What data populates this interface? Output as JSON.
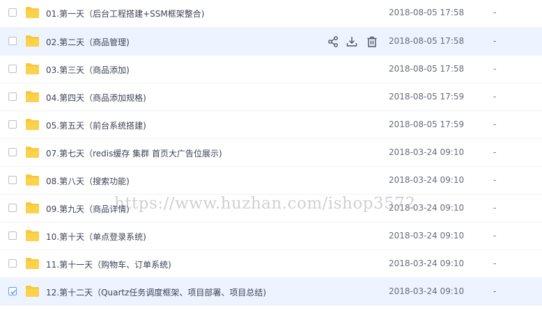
{
  "files": [
    {
      "name": "01.第一天（后台工程搭建+SSM框架整合)",
      "date": "2018-08-05 17:58",
      "size": "-"
    },
    {
      "name": "02.第二天（商品管理)",
      "date": "2018-08-05 17:58",
      "size": "-"
    },
    {
      "name": "03.第三天（商品添加)",
      "date": "2018-08-05 17:58",
      "size": "-"
    },
    {
      "name": "04.第四天（商品添加规格)",
      "date": "2018-08-05 17:59",
      "size": "-"
    },
    {
      "name": "05.第五天（前台系统搭建)",
      "date": "2018-08-05 17:59",
      "size": "-"
    },
    {
      "name": "07.第七天（redis缓存 集群 首页大广告位展示)",
      "date": "2018-03-24 09:10",
      "size": "-"
    },
    {
      "name": "08.第八天（搜索功能)",
      "date": "2018-03-24 09:10",
      "size": "-"
    },
    {
      "name": "09.第九天（商品详情)",
      "date": "2018-03-24 09:10",
      "size": "-"
    },
    {
      "name": "10.第十天（单点登录系统)",
      "date": "2018-03-24 09:10",
      "size": "-"
    },
    {
      "name": "11.第十一天（购物车、订单系统)",
      "date": "2018-03-24 09:10",
      "size": "-"
    },
    {
      "name": "12.第十二天（Quartz任务调度框架、项目部署、项目总结)",
      "date": "2018-03-24 09:10",
      "size": "-"
    }
  ],
  "row_actions": [
    "share-icon",
    "download-icon",
    "delete-icon"
  ],
  "watermark": "https://www.huzhan.com/ishop3572",
  "colors": {
    "folder": "#f9c73a",
    "accent": "#5b9bf5",
    "row_highlight": "#edf4ff"
  }
}
